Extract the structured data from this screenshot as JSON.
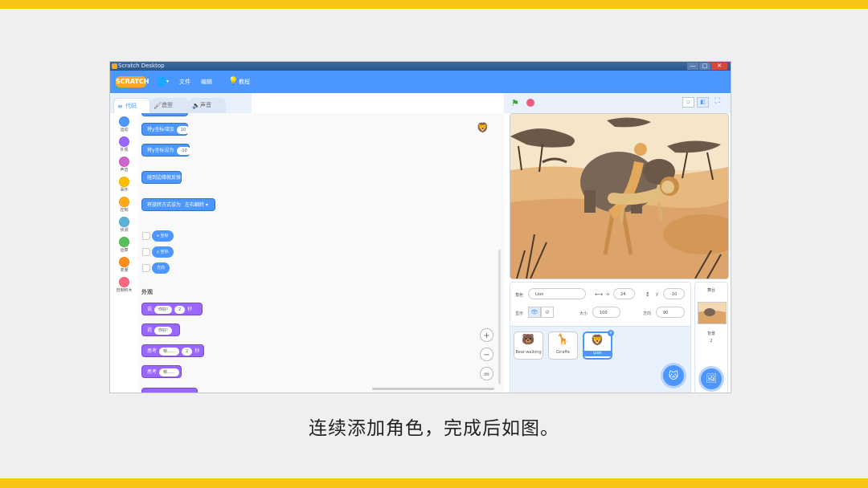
{
  "caption": "连续添加角色，完成后如图。",
  "window": {
    "title": "Scratch Desktop",
    "controls": {
      "minimize": "—",
      "maximize": "□",
      "close": "✕"
    }
  },
  "menubar": {
    "logo": "SCRATCH",
    "globe_icon": "🌐",
    "caret": "▾",
    "file": "文件",
    "edit": "编辑",
    "tutorials_icon": "💡",
    "tutorials": "教程"
  },
  "tabs": [
    {
      "label": "代码",
      "icon": "≡"
    },
    {
      "label": "造型",
      "icon": "🖌"
    },
    {
      "label": "声音",
      "icon": "🔈"
    }
  ],
  "categories": [
    {
      "label": "运动",
      "color": "#4c97ff"
    },
    {
      "label": "外观",
      "color": "#9966ff"
    },
    {
      "label": "声音",
      "color": "#cf63cf"
    },
    {
      "label": "事件",
      "color": "#ffbf00"
    },
    {
      "label": "控制",
      "color": "#ffab19"
    },
    {
      "label": "侦测",
      "color": "#5cb1d6"
    },
    {
      "label": "运算",
      "color": "#59c059"
    },
    {
      "label": "变量",
      "color": "#ff8c1a"
    },
    {
      "label": "自制积木",
      "color": "#ff6680"
    }
  ],
  "palette": {
    "y_change": {
      "text": "将y坐标增加",
      "value": "10"
    },
    "y_set": {
      "text": "将y坐标设为",
      "value": "-10"
    },
    "bounce": "碰到边缘就反弹",
    "rotation": {
      "text": "将旋转方式设为",
      "value": "左右翻转 ▾"
    },
    "x_reporter": "x 坐标",
    "y_reporter": "y 坐标",
    "dir_reporter": "方向",
    "looks_header": "外观",
    "say_secs": {
      "pre": "说",
      "msg": "你好!",
      "secs": "2",
      "post": "秒"
    },
    "say": {
      "pre": "说",
      "msg": "你好!"
    },
    "think_secs": {
      "pre": "思考",
      "msg": "嗯……",
      "secs": "2",
      "post": "秒"
    },
    "think": {
      "pre": "思考",
      "msg": "嗯……"
    }
  },
  "workspace": {
    "zoom_in": "+",
    "zoom_out": "−",
    "zoom_reset": "="
  },
  "stage_header": {
    "flag": "⚑",
    "fullscreen": "⛶"
  },
  "sprite_info": {
    "name_label": "角色",
    "name_value": "Lion",
    "x_icon": "⟷",
    "x_label": "x",
    "x_value": "24",
    "y_icon": "↕",
    "y_label": "y",
    "y_value": "-10",
    "show_label": "显示",
    "show_icon": "👁",
    "hide_icon": "⊘",
    "size_label": "大小",
    "size_value": "100",
    "dir_label": "方向",
    "dir_value": "90"
  },
  "sprites": [
    {
      "name": "Bear-walking",
      "icon": "🐻"
    },
    {
      "name": "Giraffe",
      "icon": "🦒"
    },
    {
      "name": "Lion",
      "icon": "🦁",
      "selected": true
    }
  ],
  "sprite_delete": "×",
  "add_sprite_icon": "🐱",
  "stage_panel": {
    "title": "舞台",
    "backdrops_label": "背景",
    "backdrops_count": "2",
    "add_icon": "🖼"
  },
  "colors": {
    "scratch_blue": "#4c97ff",
    "frame_yellow": "#f7c315"
  }
}
